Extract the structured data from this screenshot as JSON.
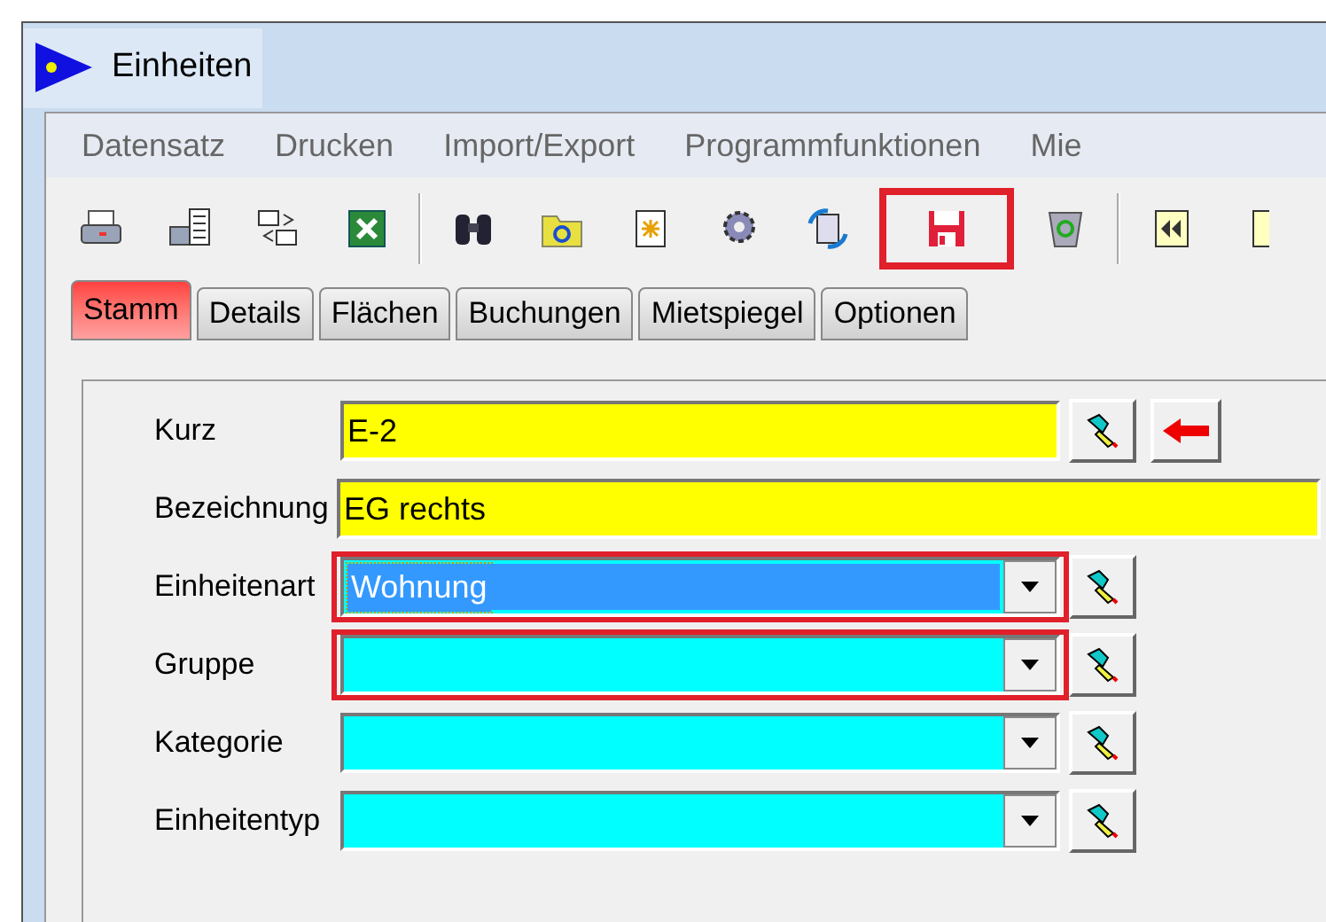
{
  "window": {
    "title": "Einheiten"
  },
  "menu": [
    "Datensatz",
    "Drucken",
    "Import/Export",
    "Programmfunktionen",
    "Mie"
  ],
  "toolbar": [
    {
      "kind": "printer",
      "highlighted": false
    },
    {
      "kind": "report",
      "highlighted": false
    },
    {
      "kind": "mail",
      "highlighted": false
    },
    {
      "kind": "excel",
      "highlighted": false
    },
    {
      "kind": "sep"
    },
    {
      "kind": "binoculars",
      "highlighted": false
    },
    {
      "kind": "folder",
      "highlighted": false
    },
    {
      "kind": "new",
      "highlighted": false
    },
    {
      "kind": "gear",
      "highlighted": false
    },
    {
      "kind": "refresh",
      "highlighted": false
    },
    {
      "kind": "save",
      "highlighted": true
    },
    {
      "kind": "trash",
      "highlighted": false
    },
    {
      "kind": "sep"
    },
    {
      "kind": "first",
      "highlighted": false
    },
    {
      "kind": "page",
      "highlighted": false
    }
  ],
  "tabs": [
    {
      "label": "Stamm",
      "selected": true
    },
    {
      "label": "Details",
      "selected": false
    },
    {
      "label": "Flächen",
      "selected": false
    },
    {
      "label": "Buchungen",
      "selected": false
    },
    {
      "label": "Mietspiegel",
      "selected": false
    },
    {
      "label": "Optionen",
      "selected": false
    }
  ],
  "fields": [
    {
      "kind": "text",
      "label": "Kurz",
      "value": "E-2",
      "lookup": true,
      "back": true,
      "wide": false,
      "highlighted": false
    },
    {
      "kind": "text",
      "label": "Bezeichnung",
      "value": "EG rechts",
      "lookup": false,
      "back": false,
      "wide": true,
      "highlighted": false
    },
    {
      "kind": "combo",
      "label": "Einheitenart",
      "value": "Wohnung",
      "lookup": true,
      "back": false,
      "wide": false,
      "focused": true,
      "highlighted": true
    },
    {
      "kind": "combo",
      "label": "Gruppe",
      "lookup": true,
      "back": false,
      "wide": false,
      "focused": false,
      "highlighted": true
    },
    {
      "kind": "combo",
      "label": "Kategorie",
      "lookup": true,
      "back": false,
      "wide": false,
      "focused": false,
      "highlighted": false
    },
    {
      "kind": "combo",
      "label": "Einheitentyp",
      "lookup": true,
      "back": false,
      "wide": false,
      "focused": false,
      "highlighted": false
    }
  ]
}
